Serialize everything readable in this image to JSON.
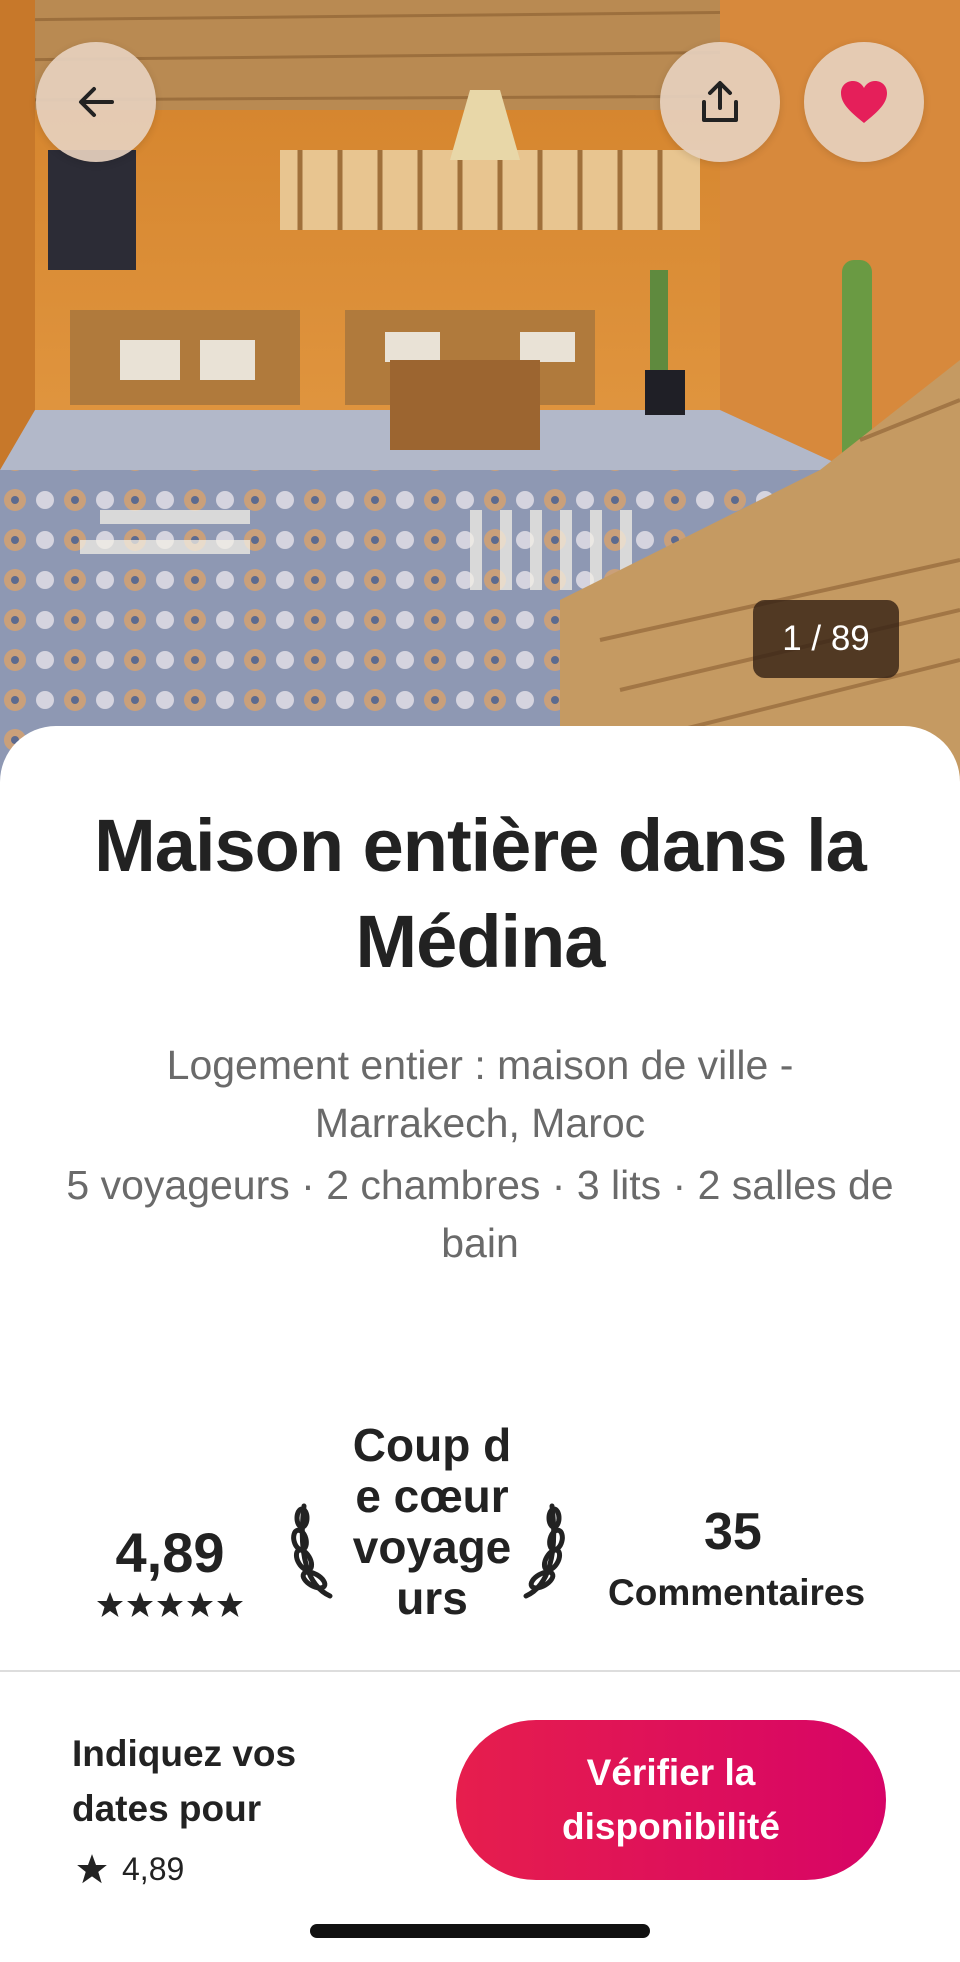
{
  "hero": {
    "photo_counter": "1 / 89",
    "back_icon": "arrow-left-icon",
    "share_icon": "share-upload-icon",
    "favorite_icon": "heart-icon",
    "favorite_color": "#e51f5a"
  },
  "listing": {
    "title": "Maison entière dans la Médina",
    "subtitle": "Logement entier : maison de ville - Marrakech, Maroc",
    "details": "5 voyageurs · 2 chambres · 3 lits · 2 salles de bain"
  },
  "stats": {
    "rating": "4,89",
    "stars": 5,
    "guest_favorite_label": "Coup de cœur voyageurs",
    "reviews_count": "35",
    "reviews_label": "Commentaires"
  },
  "footer": {
    "prompt": "Indiquez vos dates pour",
    "rating": "4,89",
    "cta_label": "Vérifier la disponibilité",
    "cta_color": "#e61e4d"
  }
}
